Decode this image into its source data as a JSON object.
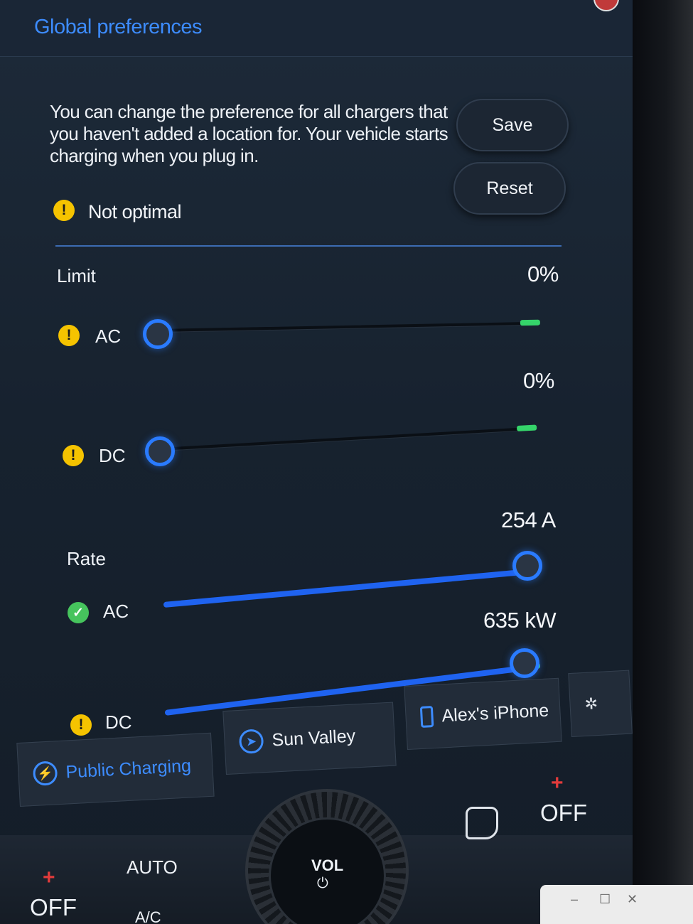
{
  "header": {
    "title": "Global preferences"
  },
  "intro": {
    "description": "You can change the preference for all chargers that you haven't added a location for. Your vehicle starts charging when you plug in."
  },
  "actions": {
    "save_label": "Save",
    "reset_label": "Reset"
  },
  "status": {
    "icon": "warning-icon",
    "text": "Not optimal"
  },
  "limit": {
    "label": "Limit",
    "ac": {
      "label": "AC",
      "value_text": "0%",
      "level_percent": 0,
      "status_icon": "warning-icon"
    },
    "dc": {
      "label": "DC",
      "value_text": "0%",
      "level_percent": 0,
      "status_icon": "warning-icon"
    }
  },
  "rate": {
    "label": "Rate",
    "ac": {
      "label": "AC",
      "value_text": "254 A",
      "level_percent": 100,
      "status_icon": "check-icon"
    },
    "dc": {
      "label": "DC",
      "value_text": "635 kW",
      "level_percent": 100,
      "status_icon": "warning-icon"
    }
  },
  "tabs": [
    {
      "label": "Public Charging",
      "icon": "charging-icon"
    },
    {
      "label": "Sun Valley",
      "icon": "location-arrow-icon"
    },
    {
      "label": "Alex's iPhone",
      "icon": "phone-icon"
    }
  ],
  "climate": {
    "left_off": "OFF",
    "right_off": "OFF",
    "auto_label": "AUTO",
    "ac_label": "A/C",
    "volume_label": "VOL"
  },
  "colors": {
    "accent": "#3d8cff",
    "slider": "#1f63f0",
    "warning": "#f5c300",
    "ok": "#46c45d",
    "limit_marker": "#35d46a"
  }
}
